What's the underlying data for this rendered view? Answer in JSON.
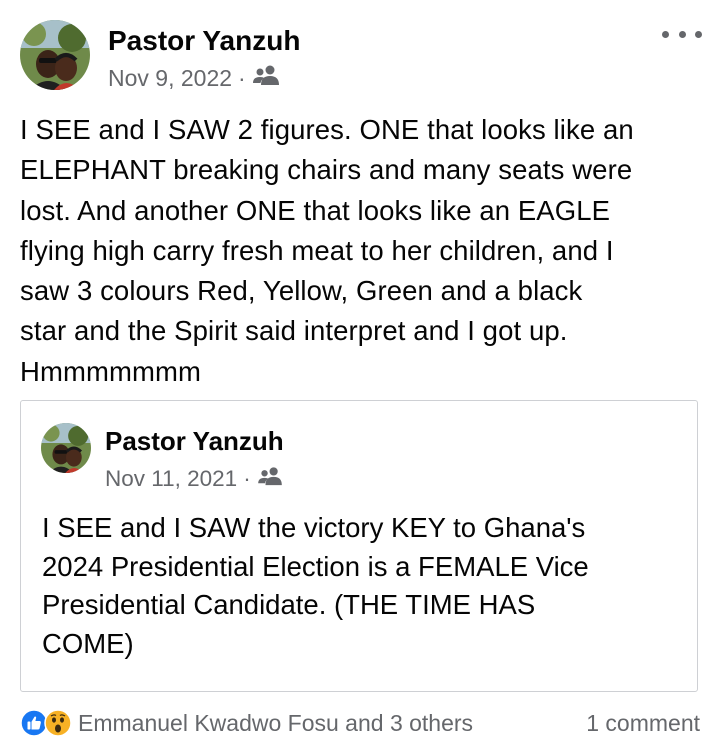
{
  "post": {
    "author": "Pastor Yanzuh",
    "date": "Nov 9, 2022",
    "separator": "·",
    "privacy_icon": "friends-icon",
    "text": "I SEE and I SAW 2 figures. ONE that looks like an\nELEPHANT breaking chairs and many seats were\nlost. And another ONE that looks like an EAGLE\nflying high carry fresh meat to her children, and I\nsaw 3 colours Red, Yellow, Green and a black\nstar and the Spirit said interpret and I got up.\nHmmmmmmm"
  },
  "shared_post": {
    "author": "Pastor Yanzuh",
    "date": "Nov 11, 2021",
    "separator": "·",
    "privacy_icon": "friends-icon",
    "text": "I SEE and I SAW the victory KEY to Ghana's\n2024 Presidential Election is a FEMALE Vice\nPresidential Candidate. (THE TIME HAS\nCOME)"
  },
  "footer": {
    "reaction_icons": [
      "like-icon",
      "wow-icon"
    ],
    "reactors": "Emmanuel Kwadwo Fosu and 3 others",
    "comments": "1 comment"
  },
  "colors": {
    "text_primary": "#050505",
    "text_secondary": "#65676b",
    "like_blue": "#1877f2",
    "wow_yellow": "#f7b125",
    "card_border": "#ced0d4"
  }
}
